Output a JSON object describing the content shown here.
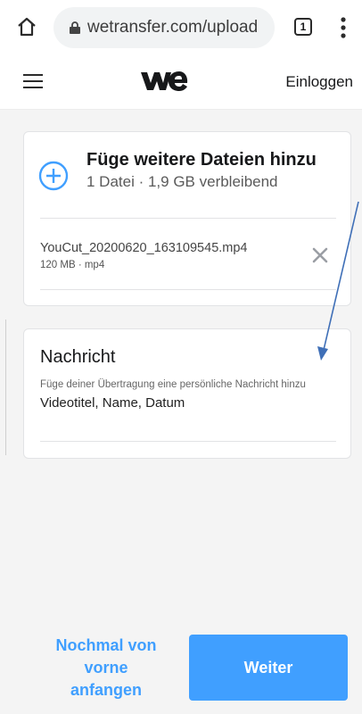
{
  "browser": {
    "url": "wetransfer.com/upload",
    "tab_count": "1"
  },
  "header": {
    "login_label": "Einloggen",
    "logo_icon": "wetransfer-we-logo"
  },
  "files_card": {
    "add_title": "Füge weitere Dateien hinzu",
    "add_subtitle": "1 Datei · 1,9 GB verbleibend",
    "files": [
      {
        "name": "YouCut_20200620_163109545.mp4",
        "meta": "120 MB · mp4"
      }
    ]
  },
  "message_card": {
    "title": "Nachricht",
    "description": "Füge deiner Übertragung eine persönliche Nachricht hinzu",
    "value": "Videotitel, Name, Datum"
  },
  "footer": {
    "restart_label": "Nochmal von vorne anfangen",
    "next_label": "Weiter"
  },
  "colors": {
    "accent": "#409fff",
    "arrow": "#3f6fb7"
  }
}
